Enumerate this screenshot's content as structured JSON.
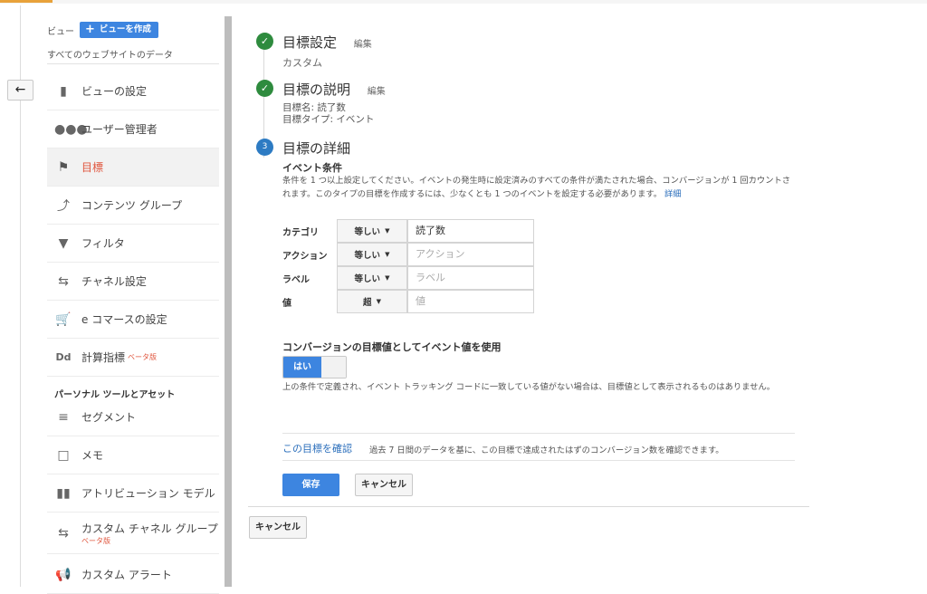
{
  "view": {
    "label": "ビュー",
    "create_label": "ビューを作成",
    "all_data": "すべてのウェブサイトのデータ"
  },
  "nav": {
    "items": [
      {
        "label": "ビューの設定",
        "icon": "document-icon"
      },
      {
        "label": "ユーザー管理者",
        "icon": "users-icon"
      },
      {
        "label": "目標",
        "icon": "flag-icon"
      },
      {
        "label": "コンテンツ グループ",
        "icon": "person-walk-icon"
      },
      {
        "label": "フィルタ",
        "icon": "filter-icon"
      },
      {
        "label": "チャネル設定",
        "icon": "channel-icon"
      },
      {
        "label": "e コマースの設定",
        "icon": "cart-icon"
      },
      {
        "label": "計算指標",
        "icon": "dd-icon",
        "badge": "ベータ版"
      },
      {
        "label": "セグメント",
        "icon": "segment-icon"
      },
      {
        "label": "メモ",
        "icon": "comment-icon"
      },
      {
        "label": "アトリビューション モデル",
        "icon": "bar-chart-icon"
      },
      {
        "label": "カスタム チャネル グループ",
        "icon": "channel-icon",
        "badge": "ベータ版"
      },
      {
        "label": "カスタム アラート",
        "icon": "megaphone-icon"
      }
    ],
    "section_personal": "パーソナル ツールとアセット"
  },
  "steps": {
    "setup": {
      "title": "目標設定",
      "edit": "編集",
      "value": "カスタム"
    },
    "description": {
      "title": "目標の説明",
      "edit": "編集",
      "name_line": "目標名: 読了数",
      "type_line": "目標タイプ: イベント"
    },
    "details": {
      "num": "3",
      "title": "目標の詳細"
    }
  },
  "event_conditions": {
    "title": "イベント条件",
    "desc": "条件を 1 つ以上設定してください。イベントの発生時に設定済みのすべての条件が満たされた場合、コンバージョンが 1 回カウントされます。このタイプの目標を作成するには、少なくとも 1 つのイベントを設定する必要があります。",
    "more": "詳細",
    "rows": [
      {
        "label": "カテゴリ",
        "op": "等しい",
        "value": "読了数",
        "placeholder": ""
      },
      {
        "label": "アクション",
        "op": "等しい",
        "value": "",
        "placeholder": "アクション"
      },
      {
        "label": "ラベル",
        "op": "等しい",
        "value": "",
        "placeholder": "ラベル"
      },
      {
        "label": "値",
        "op": "超",
        "value": "",
        "placeholder": "値"
      }
    ]
  },
  "use_value": {
    "title": "コンバージョンの目標値としてイベント値を使用",
    "toggle_on": "はい",
    "desc": "上の条件で定義され、イベント トラッキング コードに一致している値がない場合は、目標値として表示されるものはありません。"
  },
  "verify": {
    "link": "この目標を確認",
    "desc": "過去 7 日間のデータを基に、この目標で達成されたはずのコンバージョン数を確認できます。"
  },
  "buttons": {
    "save": "保存",
    "cancel": "キャンセル",
    "cancel_outer": "キャンセル"
  },
  "colors": {
    "accent_blue": "#3d85e0",
    "active_nav": "#e0573f",
    "check_green": "#2e8b3e",
    "link_blue": "#2a6ebb"
  }
}
